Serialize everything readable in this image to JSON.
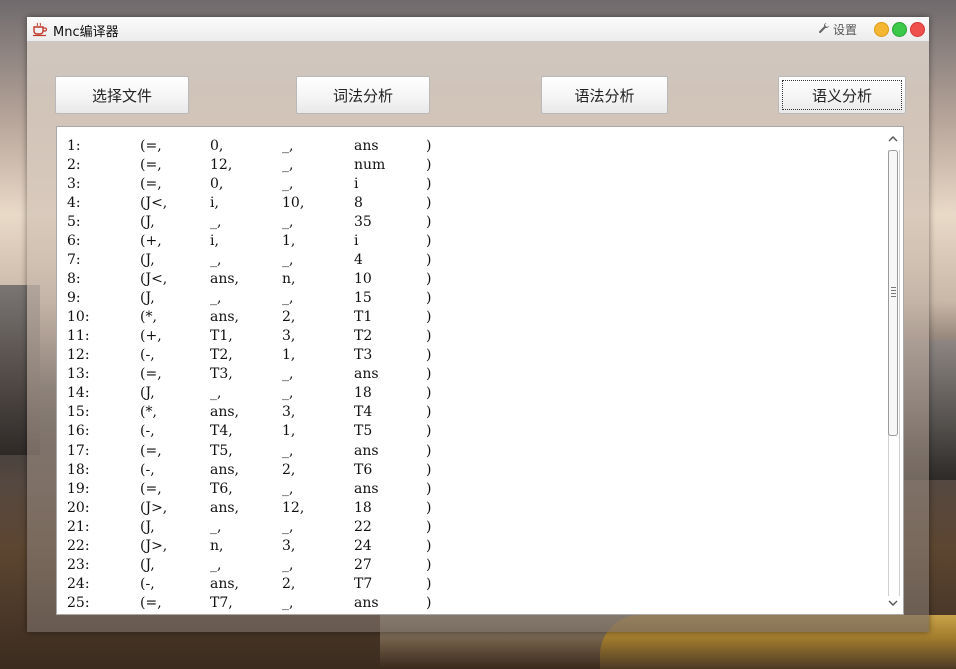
{
  "window": {
    "title": "Mnc编译器",
    "settings_label": "设置"
  },
  "toolbar": {
    "select_file": "选择文件",
    "lexical": "词法分析",
    "syntax": "语法分析",
    "semantic": "语义分析"
  },
  "colors": {
    "minimize": "#f5b731",
    "maximize": "#3cc94a",
    "close": "#f0504c"
  },
  "output": {
    "rows": [
      [
        "1:",
        "(=,",
        "0,",
        "_,",
        "ans",
        ")"
      ],
      [
        "2:",
        "(=,",
        "12,",
        "_,",
        "num",
        ")"
      ],
      [
        "3:",
        "(=,",
        "0,",
        "_,",
        "i",
        ")"
      ],
      [
        "4:",
        "(J<,",
        "i,",
        "10,",
        "8",
        ")"
      ],
      [
        "5:",
        "(J,",
        "_,",
        "_,",
        "35",
        ")"
      ],
      [
        "6:",
        "(+,",
        "i,",
        "1,",
        "i",
        ")"
      ],
      [
        "7:",
        "(J,",
        "_,",
        "_,",
        "4",
        ")"
      ],
      [
        "8:",
        "(J<,",
        "ans,",
        "n,",
        "10",
        ")"
      ],
      [
        "9:",
        "(J,",
        "_,",
        "_,",
        "15",
        ")"
      ],
      [
        "10:",
        "(*,",
        "ans,",
        "2,",
        "T1",
        ")"
      ],
      [
        "11:",
        "(+,",
        "T1,",
        "3,",
        "T2",
        ")"
      ],
      [
        "12:",
        "(-,",
        "T2,",
        "1,",
        "T3",
        ")"
      ],
      [
        "13:",
        "(=,",
        "T3,",
        "_,",
        "ans",
        ")"
      ],
      [
        "14:",
        "(J,",
        "_,",
        "_,",
        "18",
        ")"
      ],
      [
        "15:",
        "(*,",
        "ans,",
        "3,",
        "T4",
        ")"
      ],
      [
        "16:",
        "(-,",
        "T4,",
        "1,",
        "T5",
        ")"
      ],
      [
        "17:",
        "(=,",
        "T5,",
        "_,",
        "ans",
        ")"
      ],
      [
        "18:",
        "(-,",
        "ans,",
        "2,",
        "T6",
        ")"
      ],
      [
        "19:",
        "(=,",
        "T6,",
        "_,",
        "ans",
        ")"
      ],
      [
        "20:",
        "(J>,",
        "ans,",
        "12,",
        "18",
        ")"
      ],
      [
        "21:",
        "(J,",
        "_,",
        "_,",
        "22",
        ")"
      ],
      [
        "22:",
        "(J>,",
        "n,",
        "3,",
        "24",
        ")"
      ],
      [
        "23:",
        "(J,",
        "_,",
        "_,",
        "27",
        ")"
      ],
      [
        "24:",
        "(-,",
        "ans,",
        "2,",
        "T7",
        ")"
      ],
      [
        "25:",
        "(=,",
        "T7,",
        "_,",
        "ans",
        ")"
      ]
    ]
  }
}
